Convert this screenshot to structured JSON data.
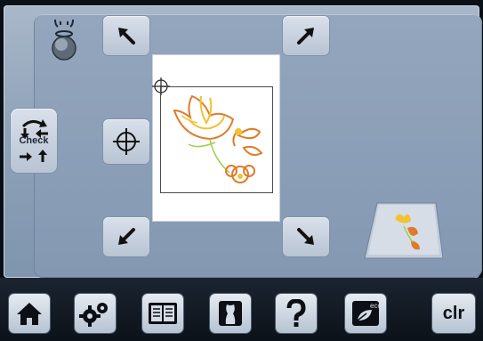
{
  "check_button": {
    "label": "Check",
    "icon": "check-arrows-icon"
  },
  "corner_buttons": [
    {
      "name": "top-left-corner-button",
      "icon": "arrow-up-left-icon"
    },
    {
      "name": "top-right-corner-button",
      "icon": "arrow-up-right-icon"
    },
    {
      "name": "bottom-left-corner-button",
      "icon": "arrow-down-left-icon"
    },
    {
      "name": "bottom-right-corner-button",
      "icon": "arrow-down-right-icon"
    }
  ],
  "center_button": {
    "icon": "crosshair-icon"
  },
  "presser_foot_icon": "presser-foot-lift-icon",
  "design_preview": {
    "icon": "embroidery-flower-icon",
    "colors": [
      "#f2c230",
      "#e07a2b",
      "#9ccf4a"
    ]
  },
  "toolbar": {
    "items": [
      {
        "name": "home-button",
        "icon": "home-icon"
      },
      {
        "name": "setup-button",
        "icon": "gears-icon"
      },
      {
        "name": "tutorial-button",
        "icon": "book-icon"
      },
      {
        "name": "consultant-button",
        "icon": "dress-form-icon"
      },
      {
        "name": "help-button",
        "icon": "question-icon"
      },
      {
        "name": "eco-button",
        "icon": "eco-leaf-icon",
        "label": "eco"
      },
      {
        "name": "clear-button",
        "label": "clr"
      }
    ]
  },
  "colors": {
    "panel": "#8fa2b8",
    "button": "#d0d8e3",
    "toolbar": "#121a24"
  }
}
